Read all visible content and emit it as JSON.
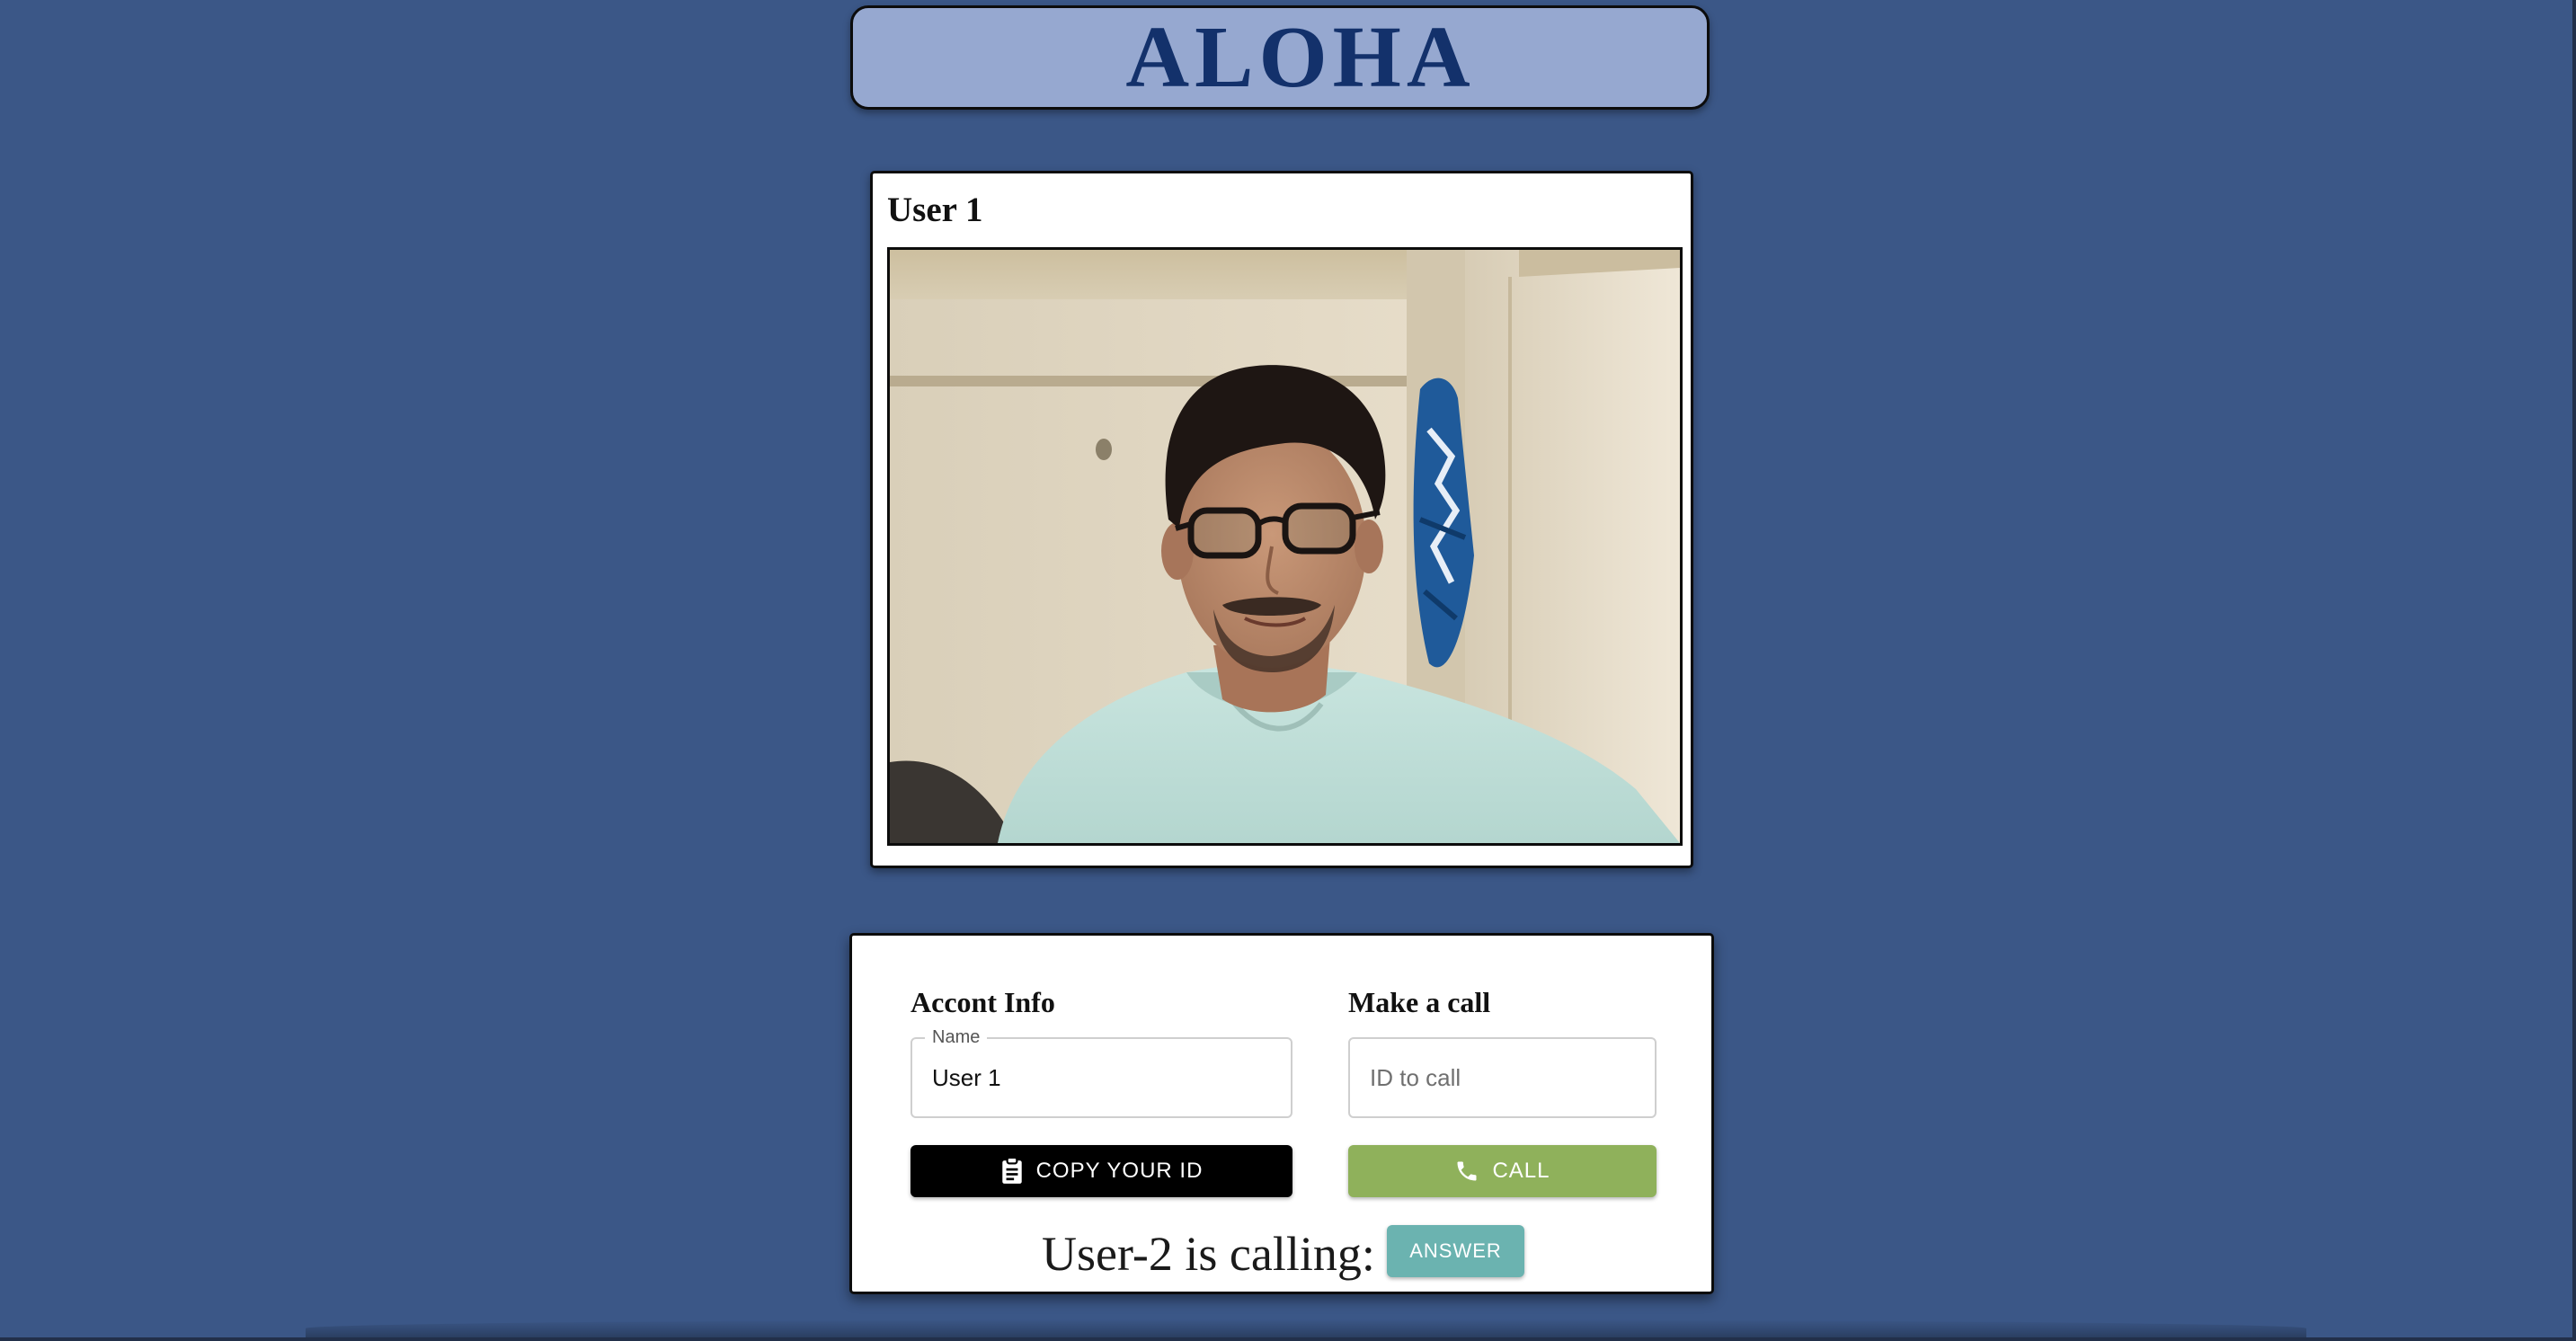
{
  "header": {
    "title": "ALOHA"
  },
  "video": {
    "user_label": "User 1"
  },
  "account": {
    "title": "Accont Info",
    "name_legend": "Name",
    "name_value": "User 1",
    "copy_label": "COPY YOUR ID",
    "copy_icon": "clipboard-icon"
  },
  "call": {
    "title": "Make a call",
    "id_placeholder": "ID to call",
    "call_label": "CALL",
    "call_icon": "phone-icon"
  },
  "incoming": {
    "text": "User-2 is calling:",
    "answer_label": "ANSWER"
  },
  "colors": {
    "background": "#3b5787",
    "header_bg": "#96a8d0",
    "header_text": "#13316b",
    "call_button": "#8fb15b",
    "answer_button": "#6bb3b0",
    "copy_button": "#000000"
  }
}
